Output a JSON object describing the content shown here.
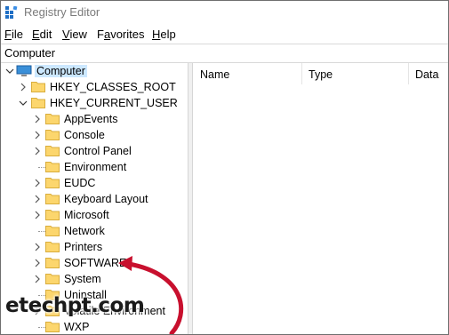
{
  "window": {
    "title": "Registry Editor"
  },
  "menu": [
    {
      "acc": "F",
      "rest": "ile"
    },
    {
      "acc": "E",
      "rest": "dit"
    },
    {
      "acc": "V",
      "rest": "iew"
    },
    {
      "pre": "F",
      "acc": "a",
      "rest": "vorites"
    },
    {
      "acc": "H",
      "rest": "elp"
    }
  ],
  "address": {
    "path": "Computer"
  },
  "tree": {
    "root": "Computer",
    "hives": [
      {
        "label": "HKEY_CLASSES_ROOT",
        "expanded": false
      },
      {
        "label": "HKEY_CURRENT_USER",
        "expanded": true
      }
    ],
    "children": [
      {
        "label": "AppEvents",
        "has_children": true
      },
      {
        "label": "Console",
        "has_children": true
      },
      {
        "label": "Control Panel",
        "has_children": true
      },
      {
        "label": "Environment",
        "has_children": false
      },
      {
        "label": "EUDC",
        "has_children": true
      },
      {
        "label": "Keyboard Layout",
        "has_children": true
      },
      {
        "label": "Microsoft",
        "has_children": true
      },
      {
        "label": "Network",
        "has_children": false
      },
      {
        "label": "Printers",
        "has_children": true
      },
      {
        "label": "SOFTWARE",
        "has_children": true
      },
      {
        "label": "System",
        "has_children": true
      },
      {
        "label": "Uninstall",
        "has_children": false
      },
      {
        "label": "Volatile Environment",
        "has_children": true
      },
      {
        "label": "WXP",
        "has_children": false
      }
    ]
  },
  "columns": [
    "Name",
    "Type",
    "Data"
  ],
  "annotation": {
    "arrow_color": "#c8102e"
  },
  "watermark": "etechpt.com"
}
